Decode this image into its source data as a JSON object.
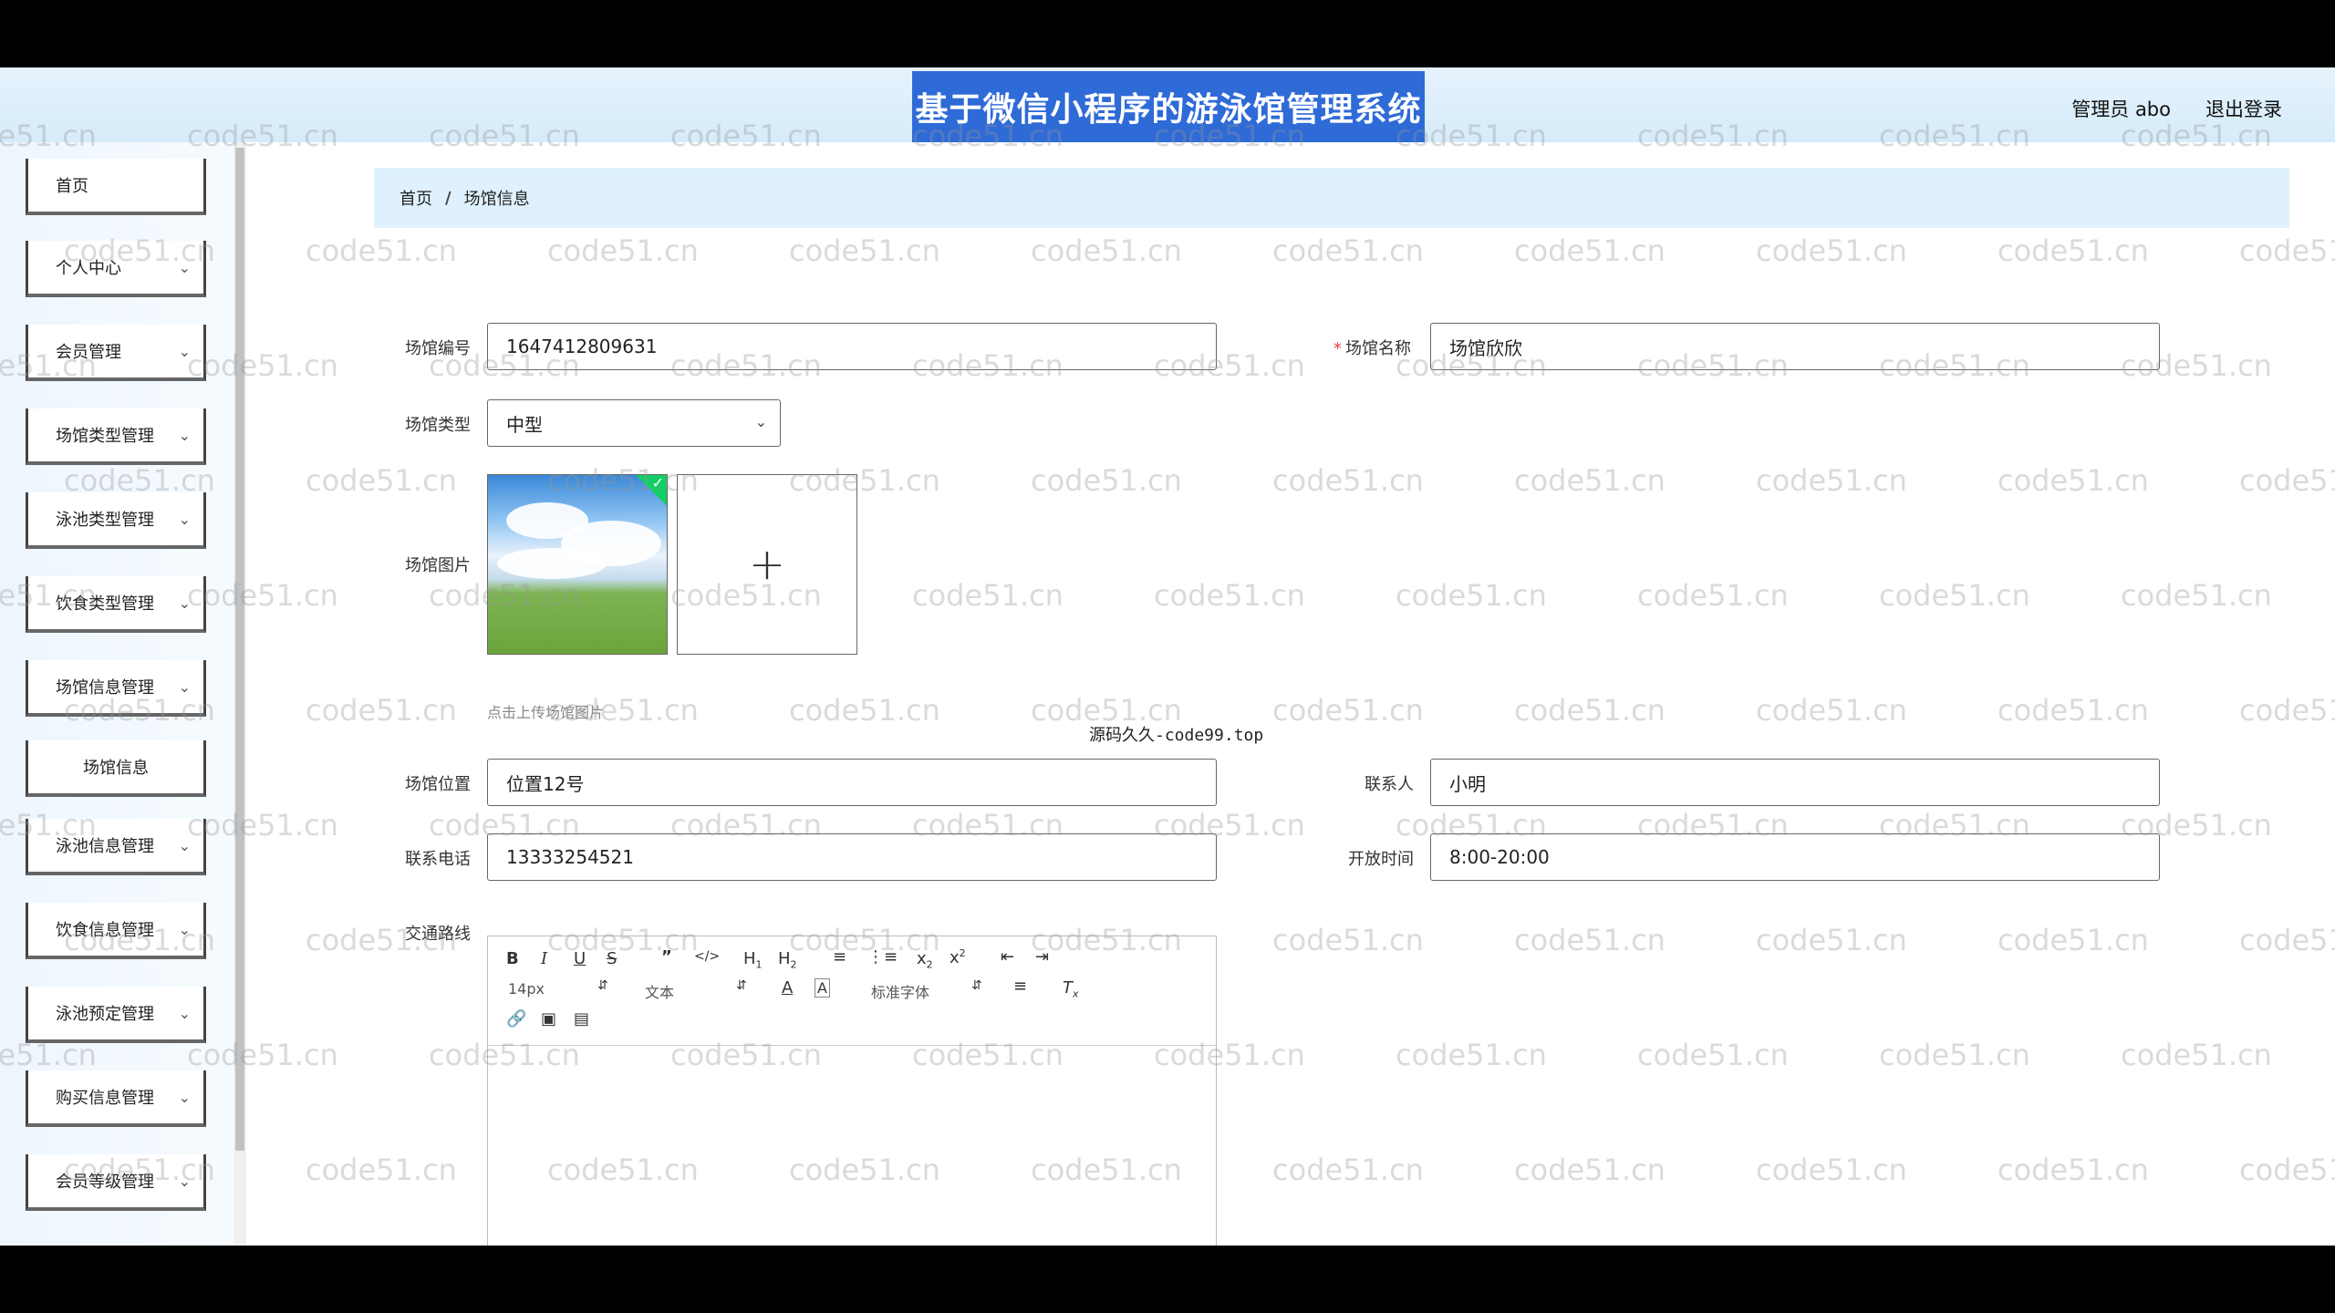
{
  "header": {
    "title": "基于微信小程序的游泳馆管理系统",
    "user": "管理员 abo",
    "logout": "退出登录"
  },
  "sidebar": {
    "items": [
      {
        "label": "首页",
        "expandable": false
      },
      {
        "label": "个人中心",
        "expandable": true
      },
      {
        "label": "会员管理",
        "expandable": true
      },
      {
        "label": "场馆类型管理",
        "expandable": true
      },
      {
        "label": "泳池类型管理",
        "expandable": true
      },
      {
        "label": "饮食类型管理",
        "expandable": true
      },
      {
        "label": "场馆信息管理",
        "expandable": true
      },
      {
        "label": "场馆信息",
        "expandable": false,
        "sub": true
      },
      {
        "label": "泳池信息管理",
        "expandable": true
      },
      {
        "label": "饮食信息管理",
        "expandable": true
      },
      {
        "label": "泳池预定管理",
        "expandable": true
      },
      {
        "label": "购买信息管理",
        "expandable": true
      },
      {
        "label": "会员等级管理",
        "expandable": true
      }
    ]
  },
  "breadcrumb": {
    "home": "首页",
    "separator": "/",
    "current": "场馆信息"
  },
  "form": {
    "venue_no": {
      "label": "场馆编号",
      "value": "1647412809631"
    },
    "venue_name": {
      "label": "场馆名称",
      "value": "场馆欣欣",
      "required": "*"
    },
    "venue_type": {
      "label": "场馆类型",
      "value": "中型"
    },
    "venue_image": {
      "label": "场馆图片",
      "hint": "点击上传场馆图片"
    },
    "venue_location": {
      "label": "场馆位置",
      "value": "位置12号"
    },
    "contact": {
      "label": "联系人",
      "value": "小明"
    },
    "phone": {
      "label": "联系电话",
      "value": "13333254521"
    },
    "open_time": {
      "label": "开放时间",
      "value": "8:00-20:00"
    },
    "route": {
      "label": "交通路线"
    }
  },
  "editor": {
    "font_size": "14px",
    "text_style": "文本",
    "font_family": "标准字体"
  },
  "overlay_text": "源码久久-code99.top",
  "watermark": "code51.cn",
  "colors": {
    "title_bg": "#2f6bd7",
    "breadcrumb_bg": "#dff1fd",
    "success": "#13ce66"
  }
}
